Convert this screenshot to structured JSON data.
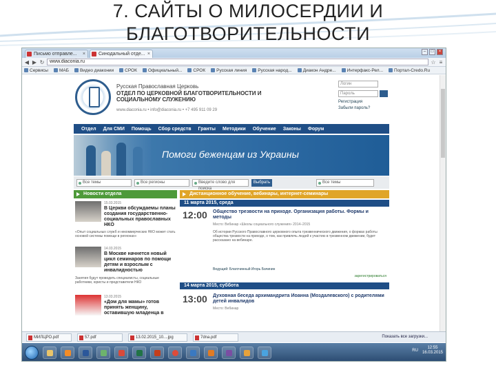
{
  "slide": {
    "title_line1": "7. САЙТЫ О МИЛОСЕРДИИ И",
    "title_line2": "БЛАГОТВОРИТЕЛЬНОСТИ"
  },
  "browser": {
    "tabs": [
      {
        "label": "Письмо отправле...",
        "active": false
      },
      {
        "label": "Синодальный отде...",
        "active": true
      }
    ],
    "url": "www.diaconia.ru",
    "bookmarks": [
      "Сервисы",
      "МАБ",
      "Видео диаконии",
      "СРОК",
      "Официальный...",
      "СРОК",
      "Русская линия",
      "Русская народ...",
      "Диакон Андре...",
      "Интерфакс-Рел...",
      "Портал-Credo.Ru"
    ]
  },
  "site": {
    "org_line1": "Русская Православная Церковь",
    "org_line2": "ОТДЕЛ ПО ЦЕРКОВНОЙ БЛАГОТВОРИТЕЛЬНОСТИ И СОЦИАЛЬНОМУ СЛУЖЕНИЮ",
    "org_contacts": "www.diaconia.ru • info@diaconia.ru • +7 495 911 09 29",
    "login_placeholder": "Логин",
    "password_placeholder": "Пароль",
    "register_link": "Регистрация",
    "forgot_link": "Забыли пароль?",
    "nav": [
      "Отдел",
      "Для СМИ",
      "Помощь",
      "Сбор средств",
      "Гранты",
      "Методики",
      "Обучение",
      "Законы",
      "Форум"
    ],
    "banner_text": "Помоги беженцам из Украины",
    "search": {
      "topic": "Все темы",
      "region": "Все регионы",
      "query": "Введите слово для поиска",
      "go": "Выбрать",
      "all_topics": "Все темы"
    },
    "left_header": "Новости отдела",
    "news": [
      {
        "date": "15.03.2015",
        "title": "В Церкви обсуждаемы планы создания государственно-социальных православных НКО",
        "body": "«Опыт социальных служб и некоммерческих НКО может стать основой системы помощи в регионах»"
      },
      {
        "date": "14.03.2015",
        "title": "В Москве начнется новый цикл семинаров по помощи детям и взрослым с инвалидностью",
        "body": "Занятия будут проводить специалисты, социальные работники, юристы и представители НКО"
      },
      {
        "date": "13.03.2015",
        "title": "«Дом для мамы» готов принять женщину, оставившую младенца в",
        "body": ""
      }
    ],
    "right_header": "Дистанционное обучение, вебинары, интернет-семинары",
    "events": [
      {
        "day": "11 марта 2015, среда",
        "time": "12:00",
        "title": "Общество трезвости на приходе. Организация работы. Формы и методы",
        "place": "Место: Вебинар «Школы социального служения» 2014–2015",
        "text": "Об истории Русского Православного церковного опыта трезвеннического движения, о формах работы общества трезвости на приходе, о том, как привлечь людей к участию в трезвенном движении, будет рассказано на вебинаре.",
        "speaker": "Ведущий: Благочинный Игорь Бачинин",
        "more": "зарегистрироваться"
      },
      {
        "day": "14 марта 2015, суббота",
        "time": "13:00",
        "title": "Духовная беседа архимандрита Иоанна (Моздалевского) с родителями детей инвалидов",
        "place": "Место: Вебинар",
        "text": "",
        "speaker": "",
        "more": ""
      }
    ]
  },
  "downloads": {
    "items": [
      "МИЛЦРО.pdf",
      "57.pdf",
      "13.02.2015_10....jpg",
      "7dna.pdf"
    ],
    "show_all": "Показать все загрузки..."
  },
  "taskbar": {
    "lang": "RU",
    "time": "12:55",
    "date": "16.03.2015"
  }
}
